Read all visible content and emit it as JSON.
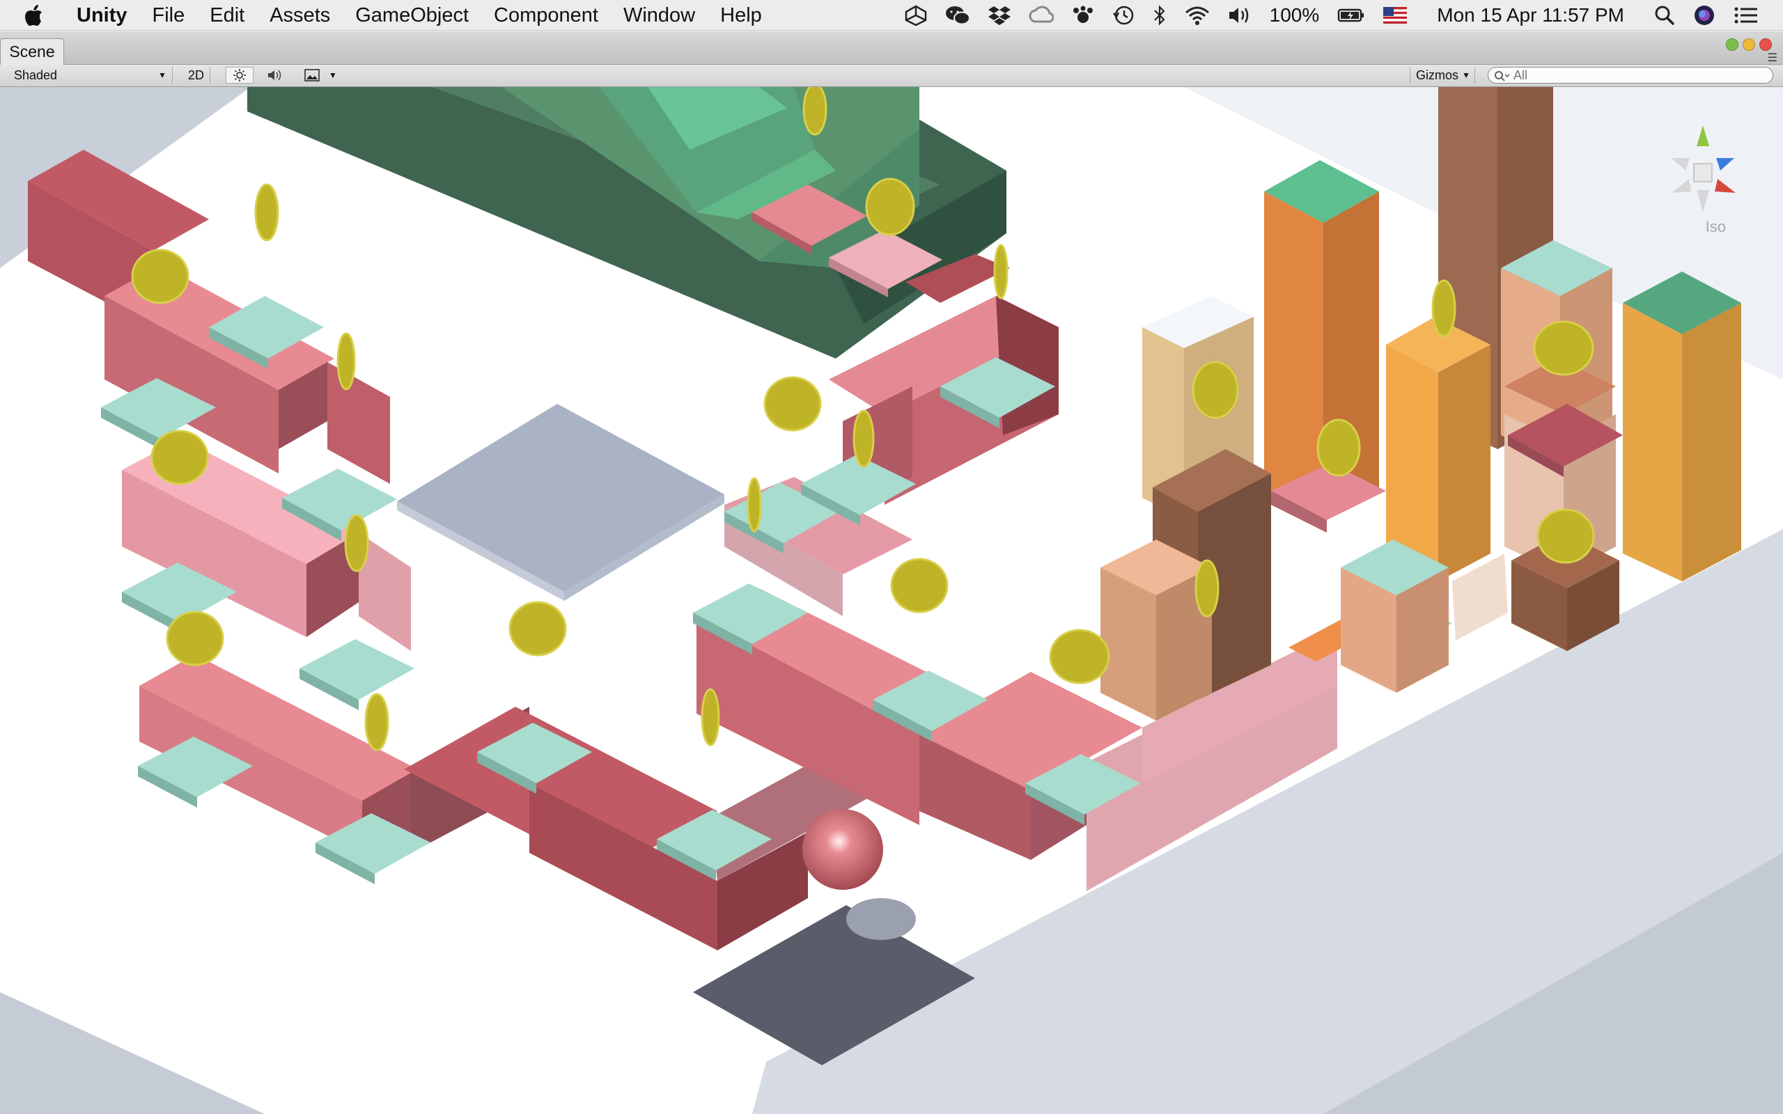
{
  "menubar": {
    "app_name": "Unity",
    "items": [
      "File",
      "Edit",
      "Assets",
      "GameObject",
      "Component",
      "Window",
      "Help"
    ],
    "battery": "100%",
    "datetime": "Mon 15 Apr  11:57 PM",
    "status_icons": [
      "unity-cloud-icon",
      "wechat-icon",
      "dropbox-icon",
      "creative-cloud-icon",
      "paw-icon",
      "time-machine-icon",
      "bluetooth-icon",
      "wifi-icon",
      "volume-icon",
      "battery-icon",
      "us-flag-icon",
      "spotlight-search-icon",
      "siri-icon",
      "notification-center-icon"
    ]
  },
  "window": {
    "tab_label": "Scene"
  },
  "toolbar": {
    "shading_mode": "Shaded",
    "mode_2d": "2D",
    "gizmos_label": "Gizmos",
    "search_placeholder": "All"
  },
  "scene": {
    "projection_label": "Iso",
    "colors": {
      "accent_coral": "#e3858c",
      "tile_mint": "#a6dccf",
      "coin_yellow": "#bfb428",
      "ball_red": "#d06b73",
      "goal_pad": "#585b68",
      "ground": "#ffffff"
    }
  }
}
